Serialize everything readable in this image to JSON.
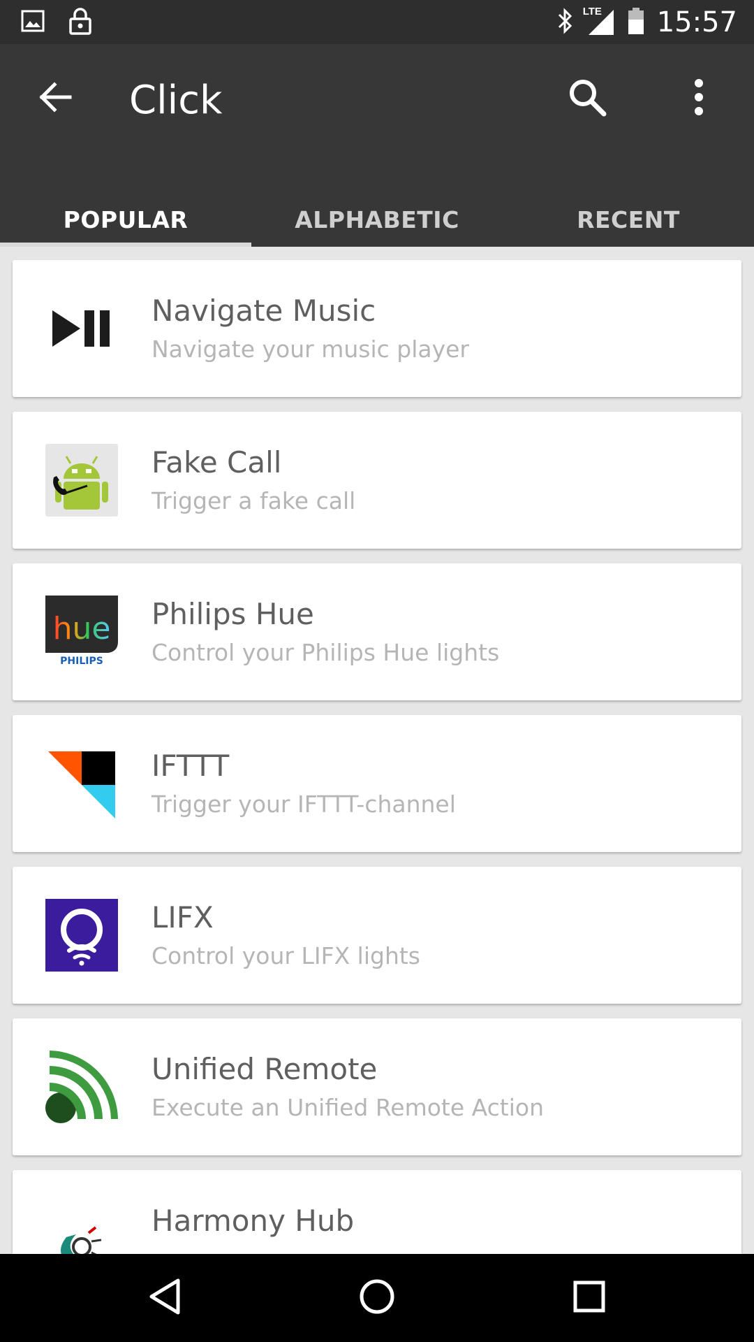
{
  "status_bar": {
    "network_label": "LTE",
    "time": "15:57"
  },
  "app_bar": {
    "title": "Click",
    "back_icon": "arrow-back-icon",
    "search_icon": "search-icon",
    "overflow_icon": "more-vert-icon"
  },
  "tabs": [
    {
      "label": "POPULAR",
      "active": true
    },
    {
      "label": "ALPHABETIC",
      "active": false
    },
    {
      "label": "RECENT",
      "active": false
    }
  ],
  "items": [
    {
      "title": "Navigate Music",
      "subtitle": "Navigate your music player",
      "icon": "play-pause-icon"
    },
    {
      "title": "Fake Call",
      "subtitle": "Trigger a fake call",
      "icon": "android-call-icon"
    },
    {
      "title": "Philips Hue",
      "subtitle": "Control your Philips Hue lights",
      "icon": "philips-hue-logo",
      "logo_text": "hue",
      "logo_brand": "PHILIPS"
    },
    {
      "title": "IFTTT",
      "subtitle": "Trigger your IFTTT-channel",
      "icon": "ifttt-logo"
    },
    {
      "title": "LIFX",
      "subtitle": "Control your LIFX lights",
      "icon": "lifx-logo"
    },
    {
      "title": "Unified Remote",
      "subtitle": "Execute an Unified Remote Action",
      "icon": "unified-remote-logo"
    },
    {
      "title": "Harmony Hub",
      "subtitle": "",
      "icon": "harmony-logo"
    }
  ],
  "colors": {
    "status_bar": "#2e2e2e",
    "app_bar": "#373737",
    "background": "#e6e6e6",
    "card": "#ffffff",
    "title_text": "#5f5f5f",
    "subtitle_text": "#b5b5b5",
    "lifx_purple": "#3b1c9c",
    "unified_green": "#3f9b3f",
    "ifttt_orange": "#ff5500",
    "ifttt_cyan": "#33ccee"
  },
  "nav_bar": {
    "back": "nav-back-icon",
    "home": "nav-home-icon",
    "recents": "nav-recents-icon"
  }
}
